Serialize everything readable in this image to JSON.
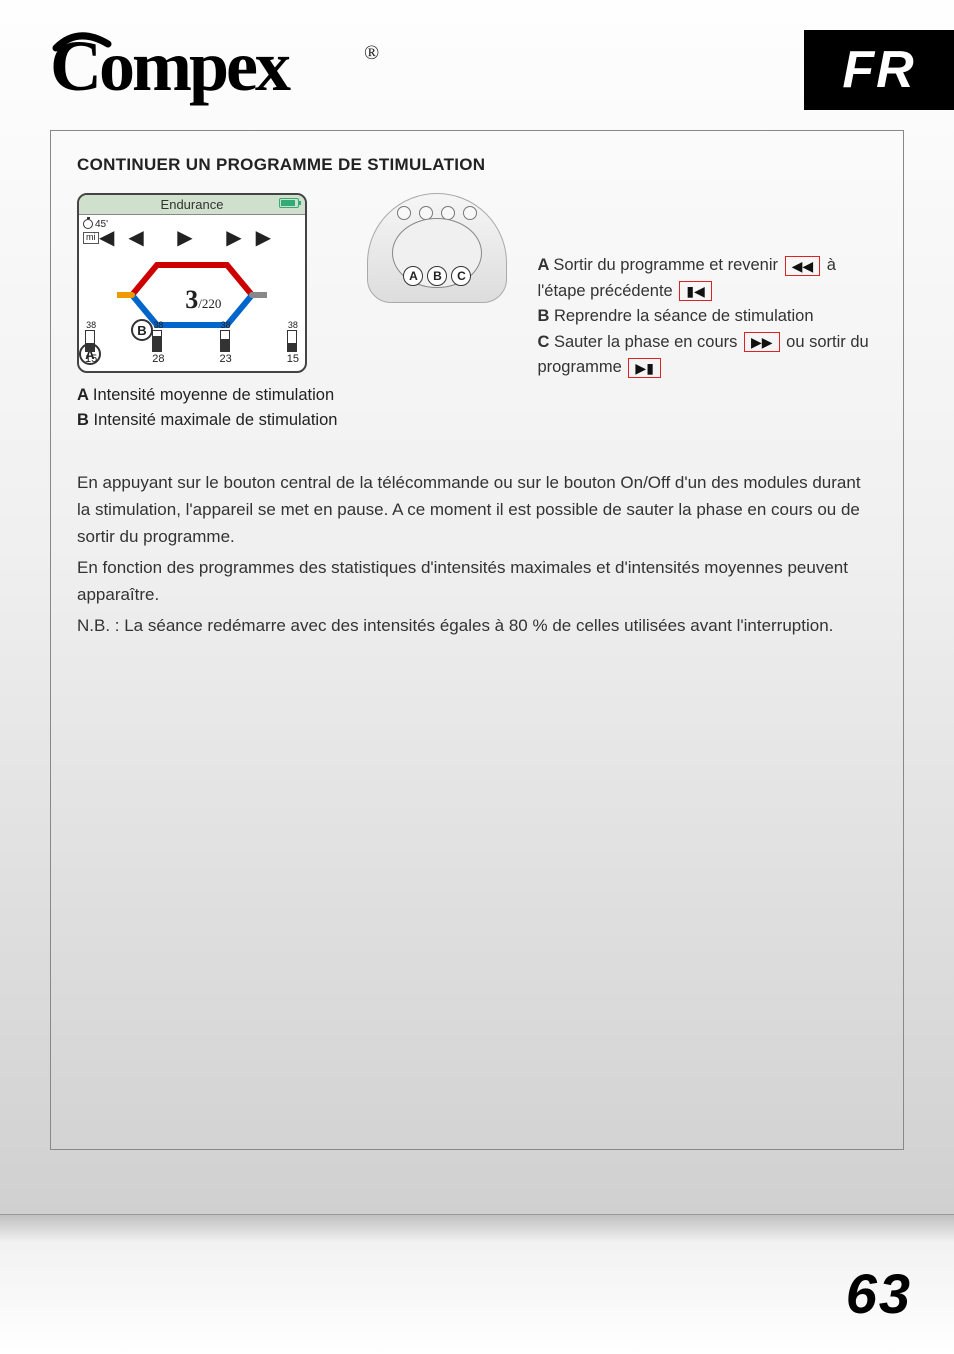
{
  "brand": "Compex",
  "trademark": "®",
  "lang_code": "FR",
  "page_number": "63",
  "section_title": "CONTINUER UN PROGRAMME DE STIMULATION",
  "screen": {
    "title": "Endurance",
    "timer": "45'",
    "mi_label": "mi",
    "rep_current": "3",
    "rep_total": "/220",
    "bars": [
      {
        "top": "38",
        "bottom": "15",
        "fill_pct": 40
      },
      {
        "top": "38",
        "bottom": "28",
        "fill_pct": 74
      },
      {
        "top": "38",
        "bottom": "23",
        "fill_pct": 60
      },
      {
        "top": "38",
        "bottom": "15",
        "fill_pct": 40
      }
    ],
    "badge_a": "A",
    "badge_b": "B"
  },
  "remote_badges": [
    "A",
    "B",
    "C"
  ],
  "left_legend": {
    "a": "Intensité moyenne de stimulation",
    "b": "Intensité maximale de stimulation"
  },
  "right_legend": {
    "a_1": "Sortir du programme et revenir",
    "a_2": "à l'étape précédente",
    "b": "Reprendre la séance de stimulation",
    "c_1": "Sauter la phase en cours",
    "c_2": "ou sortir du programme"
  },
  "icons": {
    "rewind": "◀◀",
    "skip_prev": "▮◀",
    "fast_forward": "▶▶",
    "skip_next": "▶▮",
    "play_controls": "◀◀ ▶ ▶▶"
  },
  "body": {
    "p1": "En appuyant sur le bouton central de la télécommande ou sur le bouton On/Off d'un des modules durant la stimulation, l'appareil se met en pause. A ce moment il est possible de sauter la phase en cours ou de sortir du programme.",
    "p2": "En fonction des programmes des statistiques d'intensités maximales et d'intensités moyennes peuvent apparaître.",
    "p3": "N.B. : La séance redémarre avec des intensités égales à 80 % de celles utilisées avant l'interruption."
  }
}
